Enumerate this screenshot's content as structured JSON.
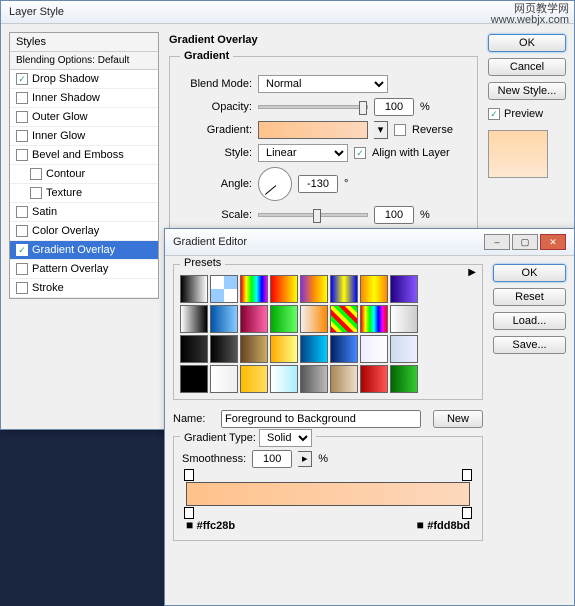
{
  "watermark": {
    "line1": "网页教学网",
    "line2": "www.webjx.com"
  },
  "layerStyle": {
    "title": "Layer Style",
    "stylesHeader": "Styles",
    "blendingDefault": "Blending Options: Default",
    "items": [
      {
        "label": "Drop Shadow",
        "checked": true
      },
      {
        "label": "Inner Shadow",
        "checked": false
      },
      {
        "label": "Outer Glow",
        "checked": false
      },
      {
        "label": "Inner Glow",
        "checked": false
      },
      {
        "label": "Bevel and Emboss",
        "checked": false
      },
      {
        "label": "Contour",
        "checked": false,
        "indent": true
      },
      {
        "label": "Texture",
        "checked": false,
        "indent": true
      },
      {
        "label": "Satin",
        "checked": false
      },
      {
        "label": "Color Overlay",
        "checked": false
      },
      {
        "label": "Gradient Overlay",
        "checked": true,
        "active": true
      },
      {
        "label": "Pattern Overlay",
        "checked": false
      },
      {
        "label": "Stroke",
        "checked": false
      }
    ],
    "sectionTitle": "Gradient Overlay",
    "groupTitle": "Gradient",
    "blendModeLabel": "Blend Mode:",
    "blendMode": "Normal",
    "opacityLabel": "Opacity:",
    "opacity": "100",
    "percent": "%",
    "gradientLabel": "Gradient:",
    "reverse": "Reverse",
    "styleLabel": "Style:",
    "style": "Linear",
    "align": "Align with Layer",
    "angleLabel": "Angle:",
    "angle": "-130",
    "deg": "°",
    "scaleLabel": "Scale:",
    "scale": "100",
    "buttons": {
      "ok": "OK",
      "cancel": "Cancel",
      "newStyle": "New Style...",
      "preview": "Preview"
    }
  },
  "gradEditor": {
    "title": "Gradient Editor",
    "presetsLabel": "Presets",
    "presets": [
      "linear-gradient(90deg,#000,#fff)",
      "repeating-conic-gradient(#9cf 0 25%,#fff 0 50%)",
      "linear-gradient(90deg,#f00,#ff0,#0f0,#0ff,#00f,#f0f)",
      "linear-gradient(90deg,#f00,#ff0)",
      "linear-gradient(90deg,#8a2be2,#ff8c00,#ff0)",
      "linear-gradient(90deg,#00f,#ff0,#00f)",
      "linear-gradient(90deg,#f80,#ff0,#f80)",
      "linear-gradient(90deg,#208,#85f)",
      "linear-gradient(90deg,#fff,#000)",
      "linear-gradient(90deg,#05a,#8cf)",
      "linear-gradient(90deg,#803,#f6a)",
      "linear-gradient(90deg,#0a0,#6f6)",
      "linear-gradient(90deg,transparent,#f80)",
      "repeating-linear-gradient(45deg,#f00 0 4px,#ff0 0 8px,#0f0 0 12px)",
      "linear-gradient(90deg,#f00,#ff0,#0f0,#0ff,#00f,#f0f,#f00)",
      "linear-gradient(90deg,#fff,#ccc)",
      "linear-gradient(90deg,#000,#333)",
      "linear-gradient(90deg,#000,#555)",
      "linear-gradient(90deg,#642,#ca6)",
      "linear-gradient(90deg,#fa0,#ff8)",
      "linear-gradient(90deg,#048,#0cf)",
      "linear-gradient(90deg,#026,#48f)",
      "linear-gradient(90deg,#eef,#fff)",
      "linear-gradient(90deg,#cde,#eef)",
      "#000",
      "linear-gradient(90deg,#fff,#eee)",
      "linear-gradient(90deg,#fb0,#fd6)",
      "linear-gradient(90deg,#fff,#aef)",
      "linear-gradient(90deg,#555,#bbb)",
      "linear-gradient(90deg,#a85,#edc)",
      "linear-gradient(90deg,#a00,#f55)",
      "linear-gradient(90deg,#060,#3c3)"
    ],
    "nameLabel": "Name:",
    "name": "Foreground to Background",
    "newBtn": "New",
    "typeLabel": "Gradient Type:",
    "type": "Solid",
    "smoothLabel": "Smoothness:",
    "smoothness": "100",
    "percent": "%",
    "hexLeft": "#ffc28b",
    "hexRight": "#fdd8bd",
    "buttons": {
      "ok": "OK",
      "reset": "Reset",
      "load": "Load...",
      "save": "Save..."
    }
  }
}
